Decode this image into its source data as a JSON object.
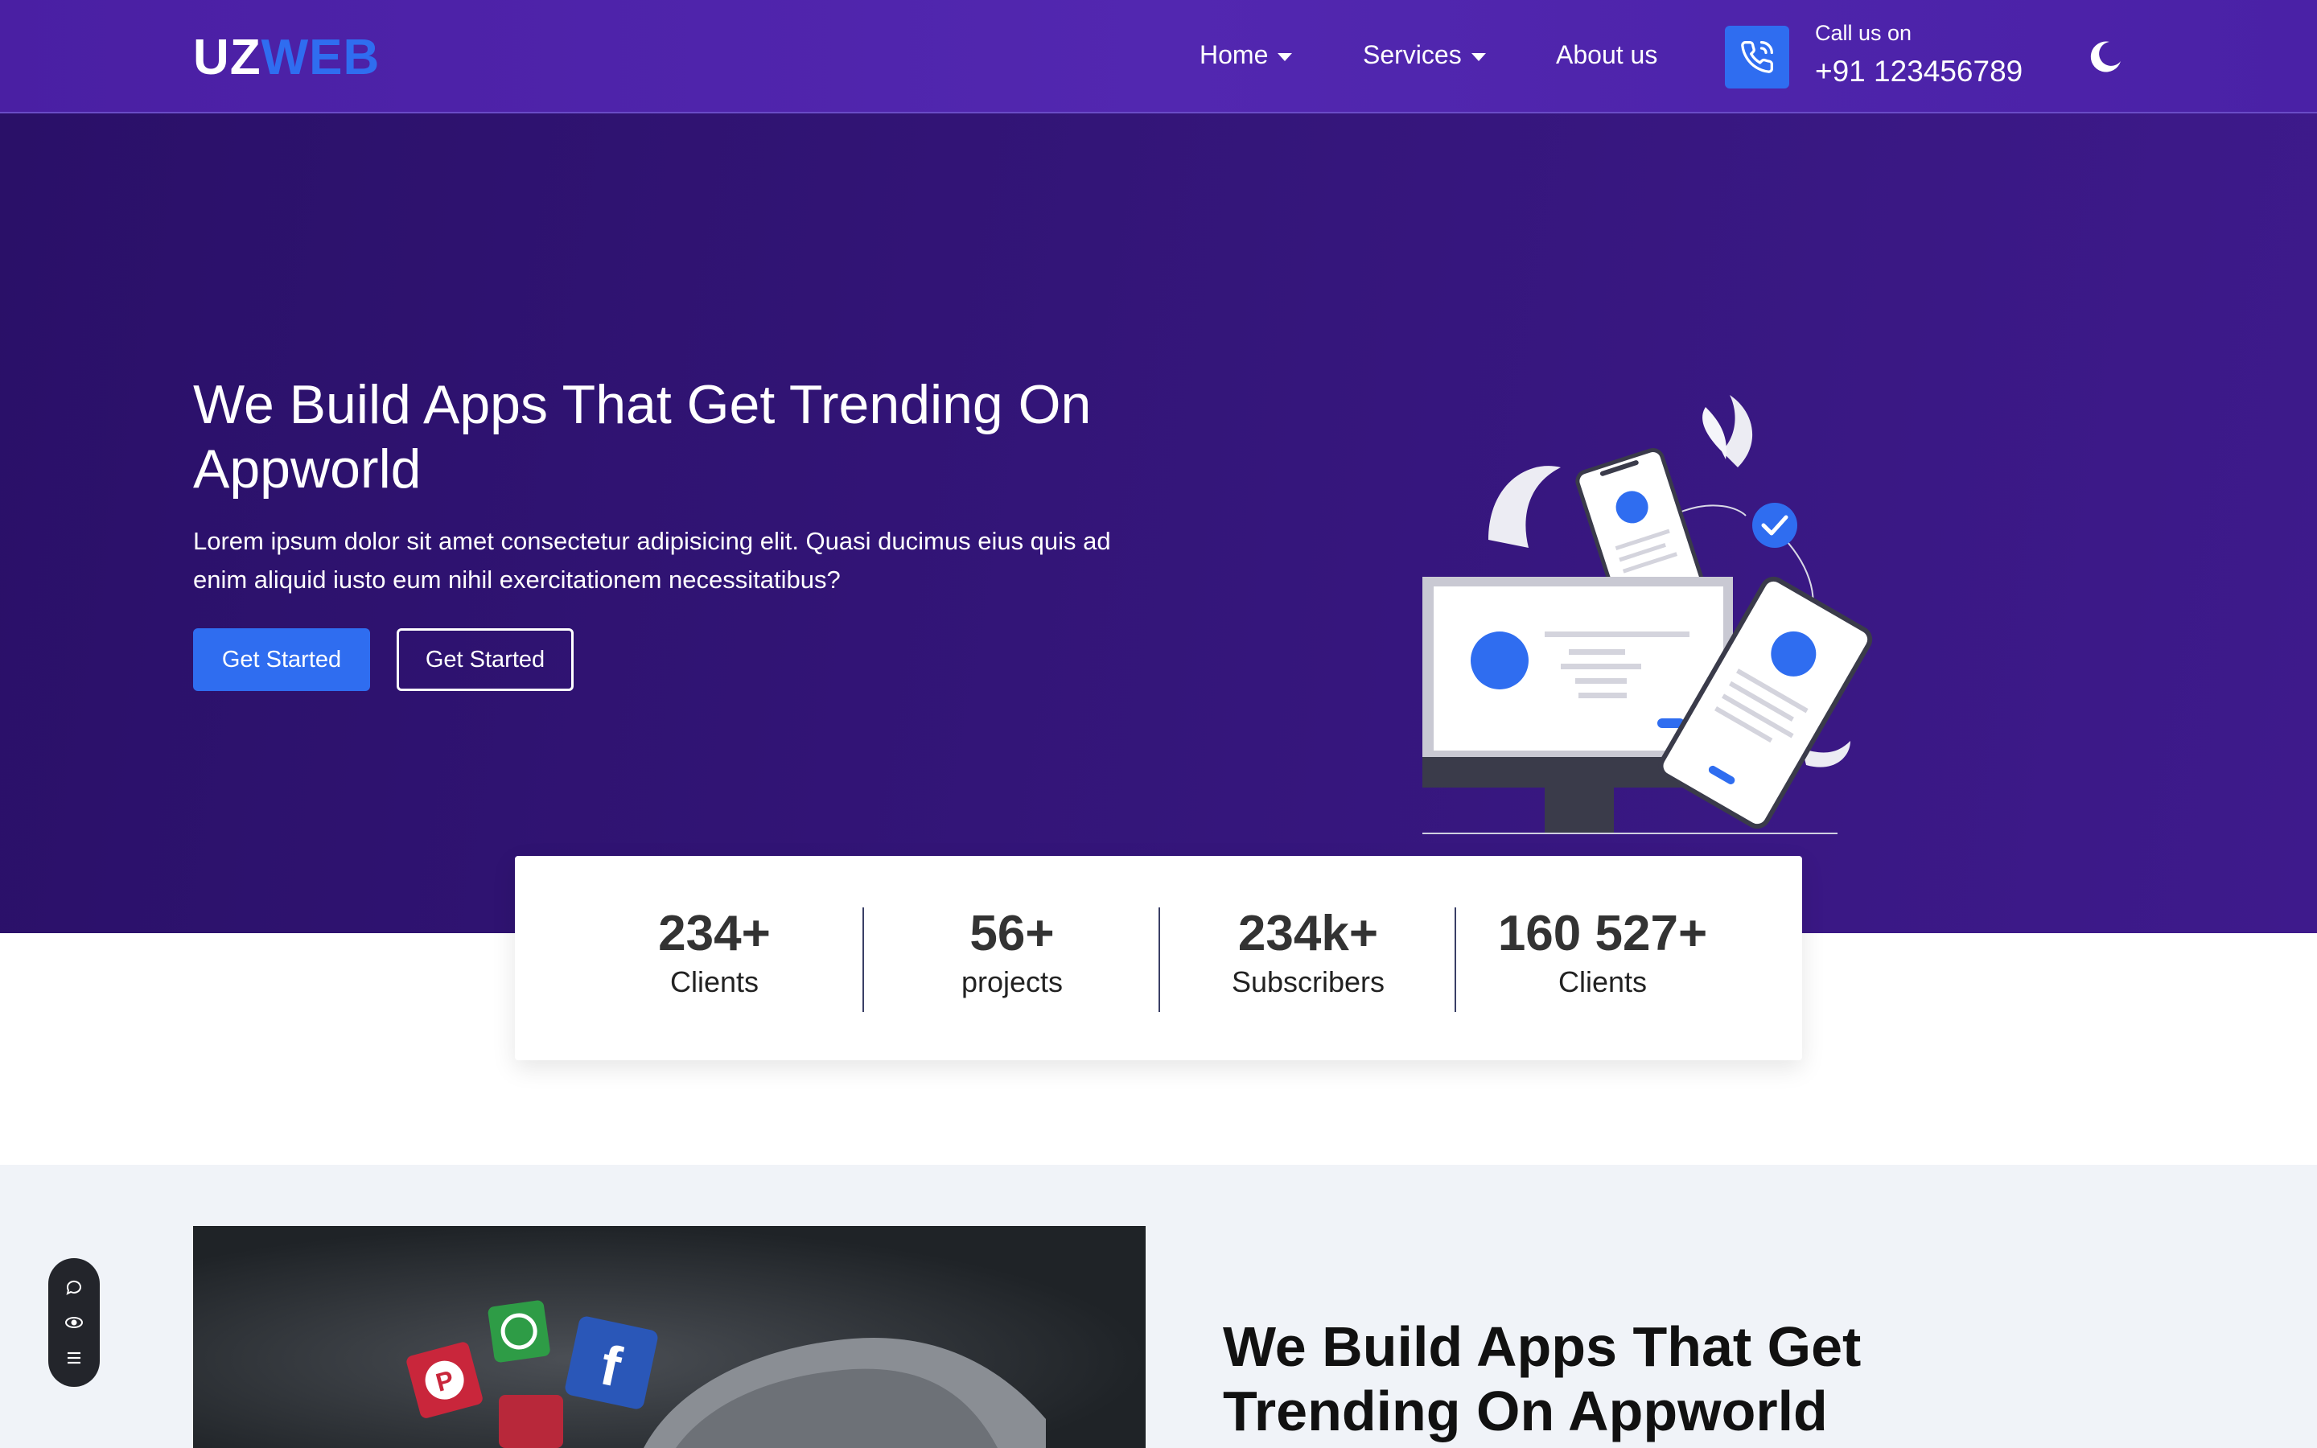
{
  "header": {
    "logo_part1": "UZ",
    "logo_part2": "WEB",
    "nav": [
      {
        "label": "Home"
      },
      {
        "label": "Services"
      },
      {
        "label": "About us"
      }
    ],
    "call_label": "Call us on",
    "call_number": "+91 123456789",
    "icons": [
      "phone-call-icon",
      "moon-icon",
      "caret-down-icon"
    ]
  },
  "hero": {
    "title": "We Build Apps That Get Trending On Appworld",
    "text": "Lorem ipsum dolor sit amet consectetur adipisicing elit. Quasi ducimus eius quis ad enim aliquid iusto eum nihil exercitationem necessitatibus?",
    "primary_button": "Get Started",
    "secondary_button": "Get Started"
  },
  "stats": [
    {
      "value": "234+",
      "label": "Clients"
    },
    {
      "value": "56+",
      "label": "projects"
    },
    {
      "value": "234k+",
      "label": "Subscribers"
    },
    {
      "value": "160 527+",
      "label": "Clients"
    }
  ],
  "section2": {
    "title": "We Build Apps That Get Trending On Appworld"
  },
  "widget": {
    "icons": [
      "chat-icon",
      "eye-icon",
      "menu-icon"
    ]
  },
  "colors": {
    "brand_blue": "#2f6df0",
    "header_purple": "#4a1fa3",
    "hero_purple": "#331578"
  }
}
